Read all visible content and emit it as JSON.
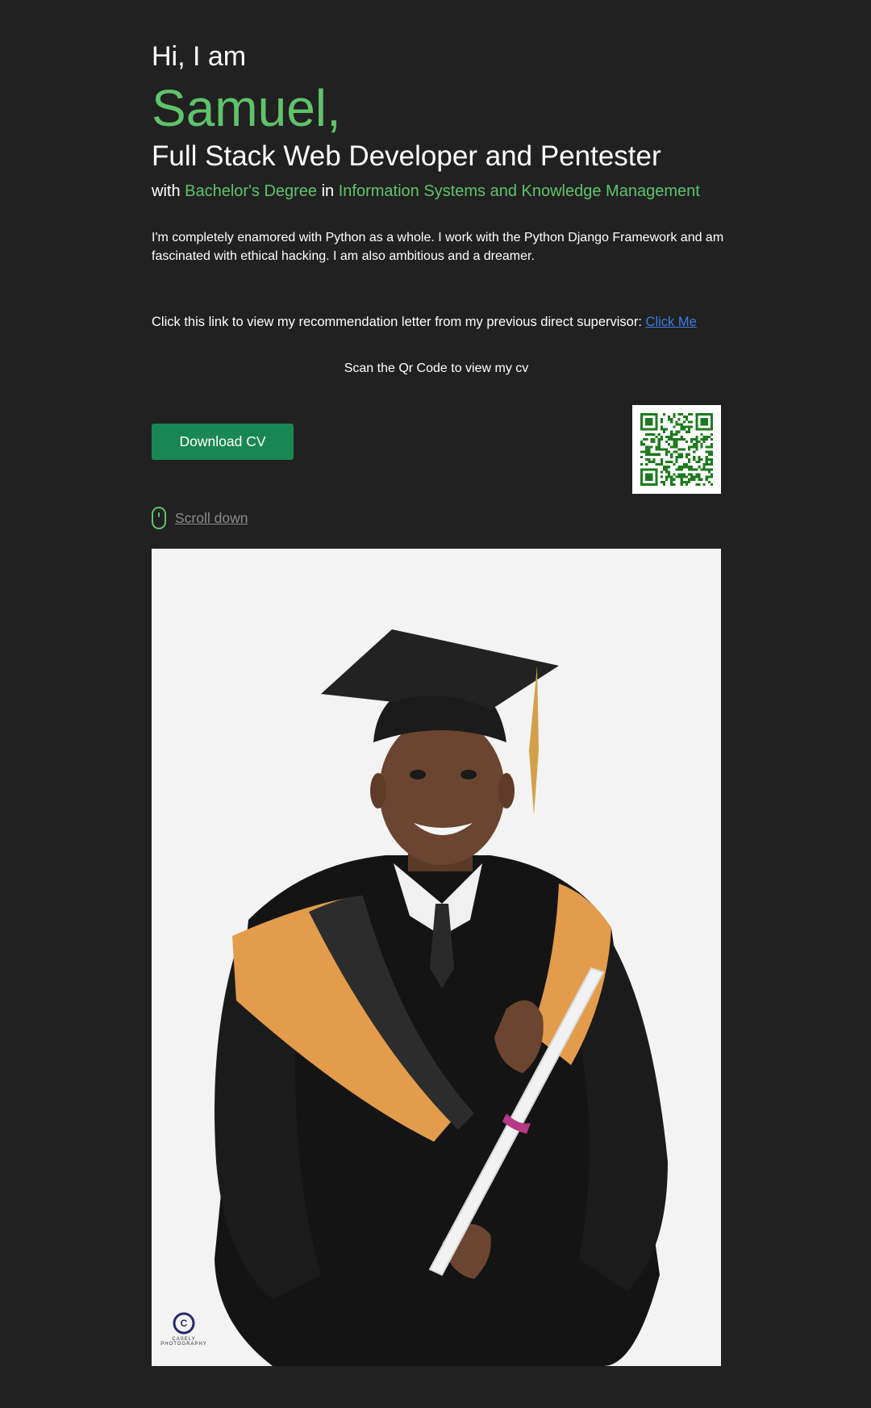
{
  "hero": {
    "greeting": "Hi, I am",
    "name": "Samuel,",
    "role": "Full Stack Web Developer and Pentester",
    "degree_prefix": "with",
    "degree": "Bachelor's Degree",
    "degree_in": "in",
    "field": "Information Systems and Knowledge Management",
    "bio": "I'm completely enamored with Python as a whole. I work with the Python Django Framework and am fascinated with ethical hacking. I am also ambitious and a dreamer."
  },
  "recommendation": {
    "text": "Click this link to view my recommendation letter from my previous direct supervisor:",
    "link_label": "Click Me"
  },
  "qr": {
    "caption": "Scan the Qr Code to view my cv",
    "icon": "qr-code-icon"
  },
  "actions": {
    "download_label": "Download CV"
  },
  "scroll": {
    "label": "Scroll down",
    "icon": "mouse-icon"
  },
  "photo": {
    "watermark": "CASELY PHOTOGRAPHY"
  },
  "colors": {
    "background": "#212121",
    "accent_green": "#5fc36b",
    "button_green": "#198754",
    "link_blue": "#3d7fe0"
  }
}
